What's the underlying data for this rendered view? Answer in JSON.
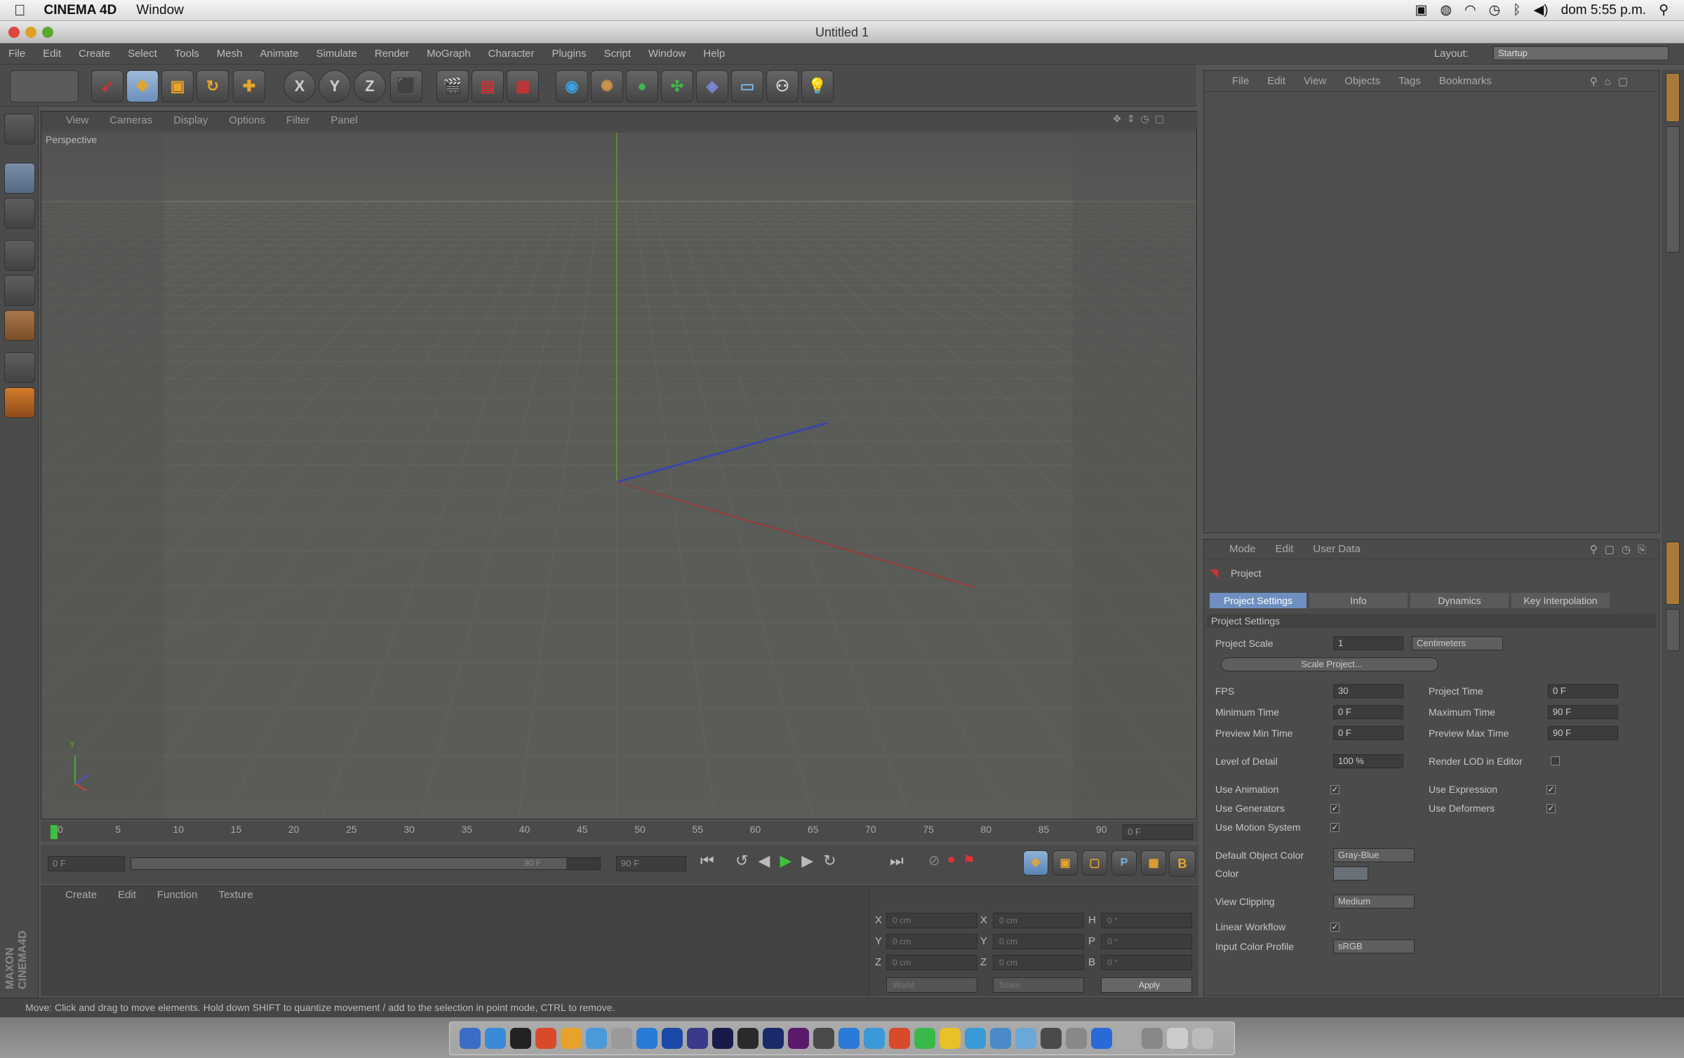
{
  "mac_menubar": {
    "app_name": "CINEMA 4D",
    "menu_window": "Window",
    "clock": "dom 5:55 p.m."
  },
  "window": {
    "title": "Untitled 1"
  },
  "c4d_menu": {
    "items": [
      "File",
      "Edit",
      "Create",
      "Select",
      "Tools",
      "Mesh",
      "Animate",
      "Simulate",
      "Render",
      "MoGraph",
      "Character",
      "Plugins",
      "Script",
      "Window",
      "Help"
    ],
    "layout_label": "Layout:",
    "layout_value": "Startup"
  },
  "toolbar": {
    "axis_x": "X",
    "axis_y": "Y",
    "axis_z": "Z"
  },
  "viewport": {
    "menu": [
      "View",
      "Cameras",
      "Display",
      "Options",
      "Filter",
      "Panel"
    ],
    "label": "Perspective",
    "gizmo_y": "Y"
  },
  "timeline": {
    "ticks": [
      "0",
      "5",
      "10",
      "15",
      "20",
      "25",
      "30",
      "35",
      "40",
      "45",
      "50",
      "55",
      "60",
      "65",
      "70",
      "75",
      "80",
      "85",
      "90"
    ],
    "frame_box": "0 F",
    "start_field": "0 F",
    "end_field": "90 F",
    "range_end": "90 F"
  },
  "materials": {
    "menu": [
      "Create",
      "Edit",
      "Function",
      "Texture"
    ]
  },
  "coordinates": {
    "axes": [
      "X",
      "Y",
      "Z"
    ],
    "size_axes": [
      "X",
      "Y",
      "Z"
    ],
    "rot_axes": [
      "H",
      "P",
      "B"
    ],
    "pos_values": [
      "0 cm",
      "0 cm",
      "0 cm"
    ],
    "size_values": [
      "0 cm",
      "0 cm",
      "0 cm"
    ],
    "rot_values": [
      "0 °",
      "0 °",
      "0 °"
    ],
    "mode_world": "World",
    "mode_scale": "Scale",
    "apply_button": "Apply"
  },
  "object_manager": {
    "menu": [
      "File",
      "Edit",
      "View",
      "Objects",
      "Tags",
      "Bookmarks"
    ]
  },
  "attribute_manager": {
    "menu": [
      "Mode",
      "Edit",
      "User Data"
    ],
    "object_label": "Project",
    "tabs": [
      "Project Settings",
      "Info",
      "Dynamics",
      "Key Interpolation"
    ],
    "section": "Project Settings",
    "project_scale_label": "Project Scale",
    "project_scale_value": "1",
    "project_scale_unit": "Centimeters",
    "scale_project_button": "Scale Project...",
    "fps_label": "FPS",
    "fps_value": "30",
    "project_time_label": "Project Time",
    "project_time_value": "0 F",
    "min_time_label": "Minimum Time",
    "min_time_value": "0 F",
    "max_time_label": "Maximum Time",
    "max_time_value": "90 F",
    "preview_min_label": "Preview Min Time",
    "preview_min_value": "0 F",
    "preview_max_label": "Preview Max Time",
    "preview_max_value": "90 F",
    "lod_label": "Level of Detail",
    "lod_value": "100 %",
    "render_lod_label": "Render LOD in Editor",
    "use_animation_label": "Use Animation",
    "use_expression_label": "Use Expression",
    "use_generators_label": "Use Generators",
    "use_deformers_label": "Use Deformers",
    "use_motion_label": "Use Motion System",
    "default_color_label": "Default Object Color",
    "default_color_value": "Gray-Blue",
    "color_label": "Color",
    "view_clipping_label": "View Clipping",
    "view_clipping_value": "Medium",
    "linear_workflow_label": "Linear Workflow",
    "input_profile_label": "Input Color Profile",
    "input_profile_value": "sRGB",
    "check_mark": "✓"
  },
  "status_bar": {
    "text": "Move: Click and drag to move elements. Hold down SHIFT to quantize movement / add to the selection in point mode, CTRL to remove."
  },
  "maxon_logo": "MAXON CINEMA4D",
  "colors": {
    "bg": "#4a4a4a",
    "tab_active": "#6e8fc0",
    "x_axis": "#9a3a3a",
    "y_axis": "#4a8a3a",
    "z_axis": "#3a4aa8"
  }
}
